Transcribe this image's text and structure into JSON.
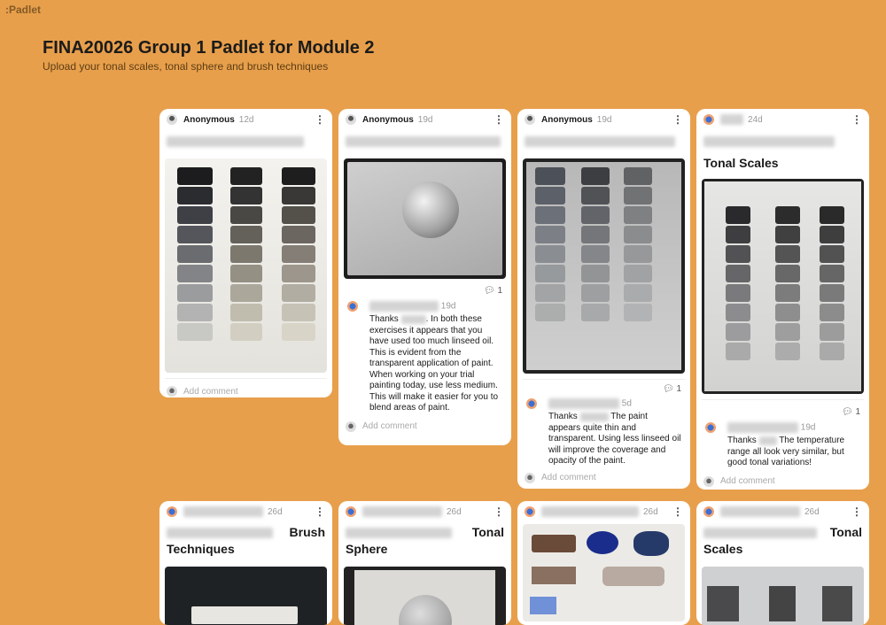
{
  "app": {
    "logo": ":Padlet"
  },
  "board": {
    "title": "FINA20026 Group 1 Padlet for Module 2",
    "subtitle": "Upload your tonal scales, tonal sphere and brush techniques"
  },
  "colors": {
    "background": "#E89F4B",
    "card": "#FFFFFF"
  },
  "posts": [
    {
      "author": "Anonymous",
      "time": "12d",
      "add_comment": "Add comment"
    },
    {
      "author": "Anonymous",
      "time": "19d",
      "comment_count": "1",
      "comment": {
        "time": "19d",
        "text_pre": "Thanks",
        "text": ". In both these exercises it appears that you have used too much linseed oil. This is evident from the transparent application of paint. When working on your trial painting today, use less medium. This will make it easier for you to blend areas of paint."
      },
      "add_comment": "Add comment"
    },
    {
      "author": "Anonymous",
      "time": "19d",
      "comment_count": "1",
      "comment": {
        "time": "5d",
        "text_pre": "Thanks",
        "text": "The paint appears quite thin and transparent. Using less linseed oil will improve the coverage and opacity of the paint."
      },
      "add_comment": "Add comment"
    },
    {
      "time": "24d",
      "title": "Tonal Scales",
      "comment_count": "1",
      "comment": {
        "time": "19d",
        "text_pre": "Thanks",
        "text": "The temperature range all look very similar, but good tonal variations!"
      },
      "add_comment": "Add comment"
    },
    {
      "time": "26d",
      "title_a": "Brush",
      "title_b": "Techniques"
    },
    {
      "time": "26d",
      "title_a": "Tonal",
      "title_b": "Sphere"
    },
    {
      "time": "26d"
    },
    {
      "time": "26d",
      "title_a": "Tonal",
      "title_b": "Scales"
    }
  ]
}
